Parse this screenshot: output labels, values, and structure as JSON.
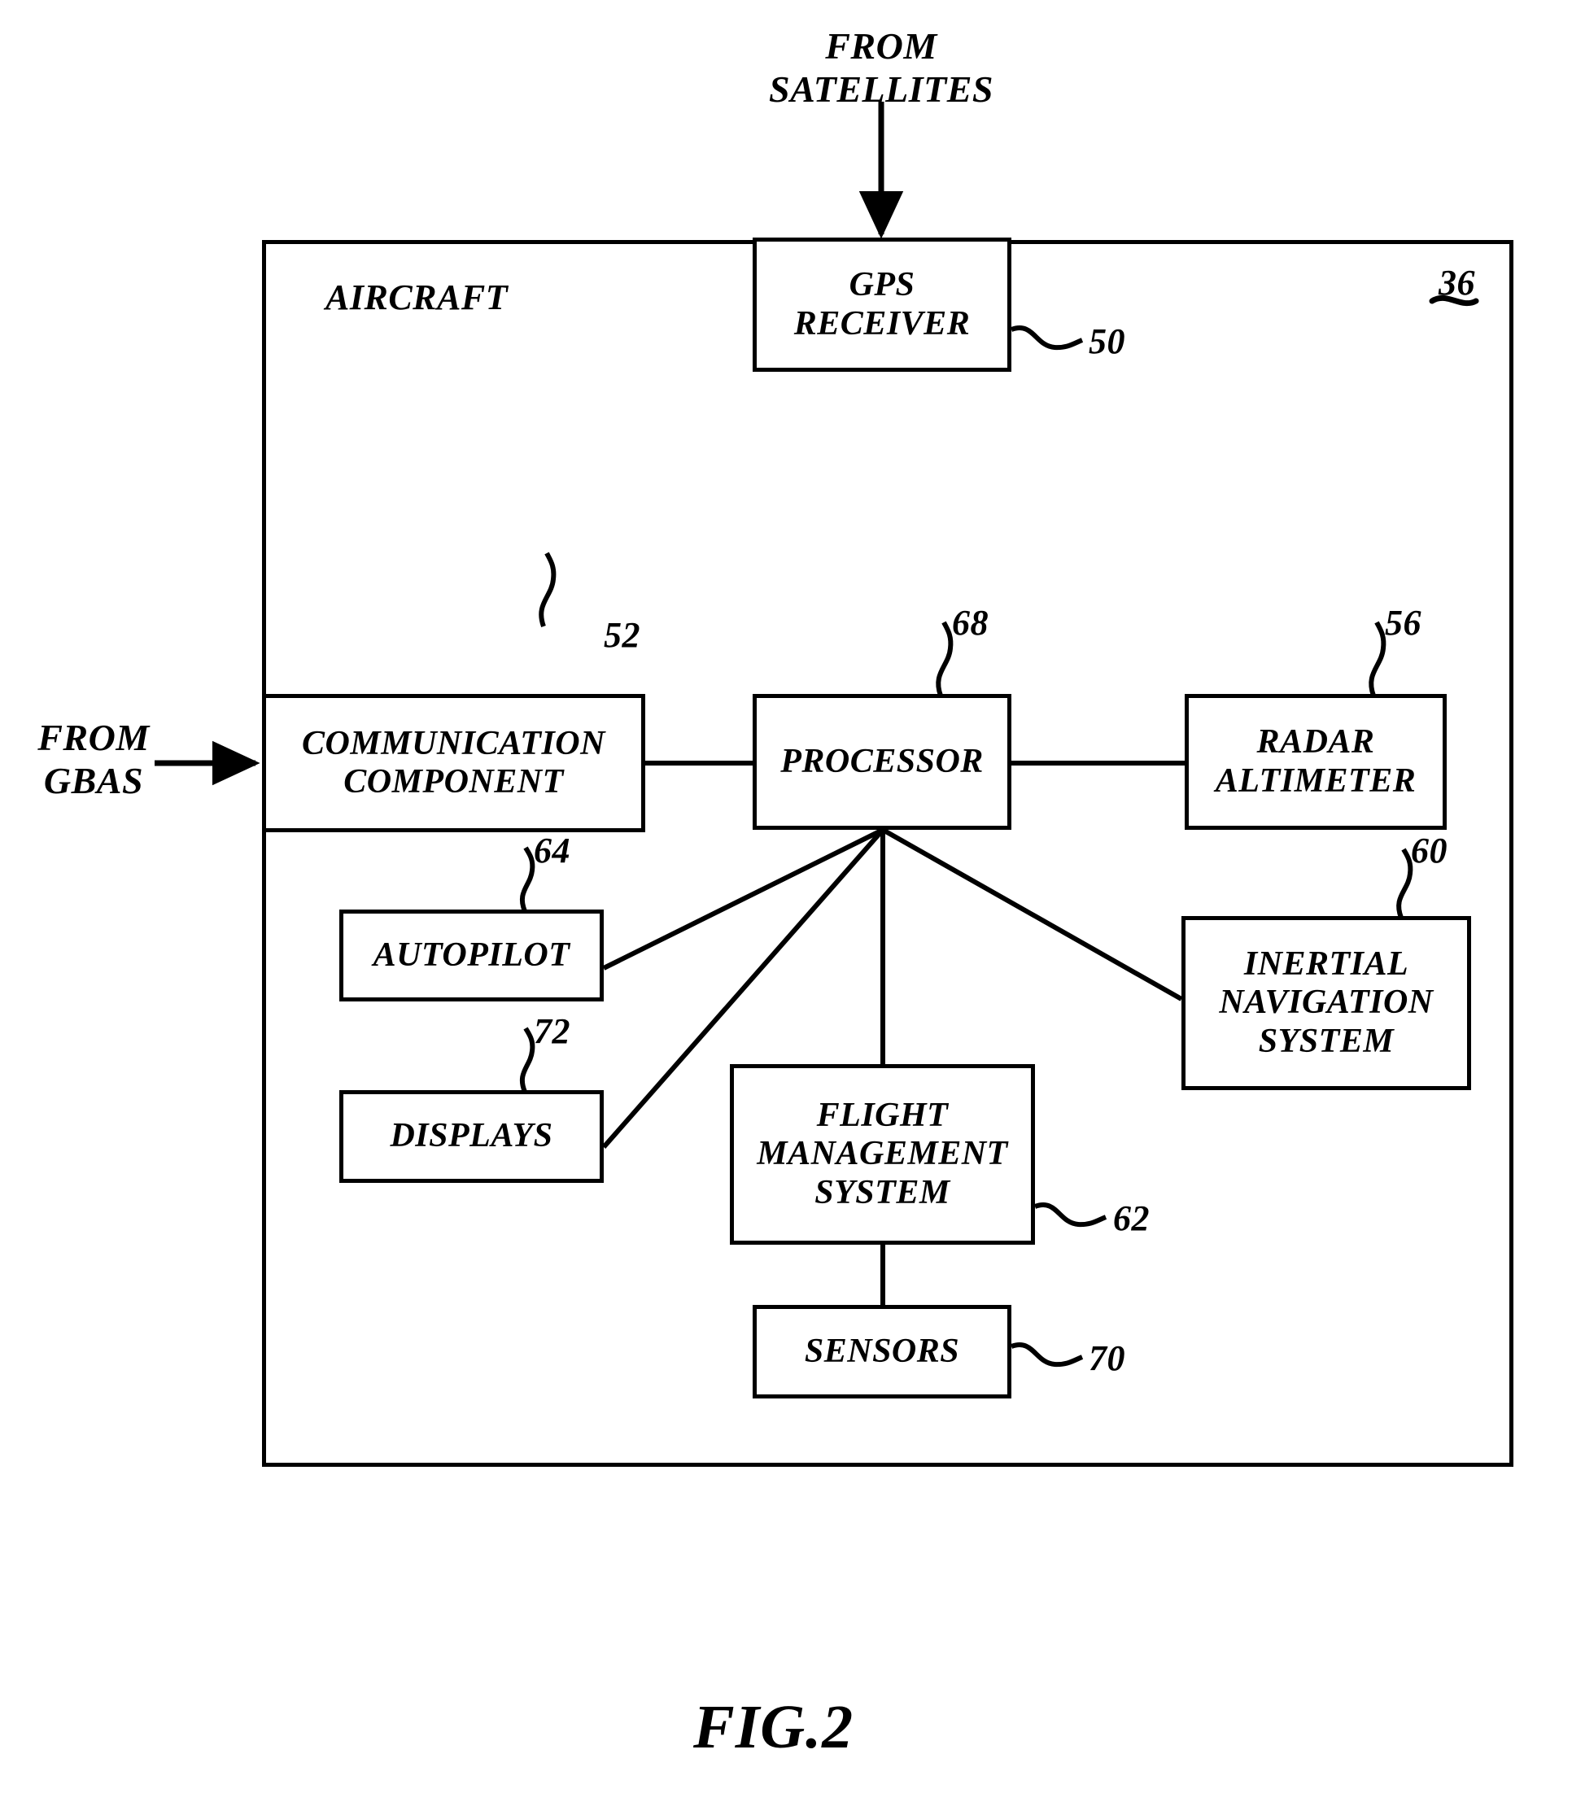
{
  "figure": {
    "caption": "FIG.2",
    "frame_label": "AIRCRAFT",
    "frame_ref": "36"
  },
  "external_labels": [
    {
      "id": "from-satellites",
      "text": "FROM\nSATELLITES"
    },
    {
      "id": "from-gbas",
      "text": "FROM\nGBAS"
    }
  ],
  "nodes": [
    {
      "id": "gps-receiver",
      "label": "GPS\nRECEIVER",
      "ref": "50"
    },
    {
      "id": "communication-component",
      "label": "COMMUNICATION\nCOMPONENT",
      "ref": "52"
    },
    {
      "id": "processor",
      "label": "PROCESSOR",
      "ref": "68"
    },
    {
      "id": "radar-altimeter",
      "label": "RADAR\nALTIMETER",
      "ref": "56"
    },
    {
      "id": "autopilot",
      "label": "AUTOPILOT",
      "ref": "64"
    },
    {
      "id": "displays",
      "label": "DISPLAYS",
      "ref": "72"
    },
    {
      "id": "inertial-navigation-system",
      "label": "INERTIAL\nNAVIGATION\nSYSTEM",
      "ref": "60"
    },
    {
      "id": "flight-management-system",
      "label": "FLIGHT\nMANAGEMENT\nSYSTEM",
      "ref": "62"
    },
    {
      "id": "sensors",
      "label": "SENSORS",
      "ref": "70"
    }
  ],
  "chart_data": {
    "type": "diagram",
    "title": "FIG.2",
    "container": {
      "label": "AIRCRAFT",
      "ref": "36"
    },
    "blocks": [
      {
        "ref": "50",
        "label": "GPS RECEIVER"
      },
      {
        "ref": "52",
        "label": "COMMUNICATION COMPONENT"
      },
      {
        "ref": "56",
        "label": "RADAR ALTIMETER"
      },
      {
        "ref": "60",
        "label": "INERTIAL NAVIGATION SYSTEM"
      },
      {
        "ref": "62",
        "label": "FLIGHT MANAGEMENT SYSTEM"
      },
      {
        "ref": "64",
        "label": "AUTOPILOT"
      },
      {
        "ref": "68",
        "label": "PROCESSOR"
      },
      {
        "ref": "70",
        "label": "SENSORS"
      },
      {
        "ref": "72",
        "label": "DISPLAYS"
      }
    ],
    "edges": [
      {
        "from": "FROM SATELLITES",
        "to": "GPS RECEIVER",
        "arrow": true
      },
      {
        "from": "FROM GBAS",
        "to": "COMMUNICATION COMPONENT",
        "arrow": true
      },
      {
        "from": "COMMUNICATION COMPONENT",
        "to": "PROCESSOR",
        "arrow": false
      },
      {
        "from": "PROCESSOR",
        "to": "RADAR ALTIMETER",
        "arrow": false
      },
      {
        "from": "PROCESSOR",
        "to": "AUTOPILOT",
        "arrow": false
      },
      {
        "from": "PROCESSOR",
        "to": "DISPLAYS",
        "arrow": false
      },
      {
        "from": "PROCESSOR",
        "to": "FLIGHT MANAGEMENT SYSTEM",
        "arrow": false
      },
      {
        "from": "PROCESSOR",
        "to": "INERTIAL NAVIGATION SYSTEM",
        "arrow": false
      },
      {
        "from": "FLIGHT MANAGEMENT SYSTEM",
        "to": "SENSORS",
        "arrow": false
      }
    ]
  }
}
